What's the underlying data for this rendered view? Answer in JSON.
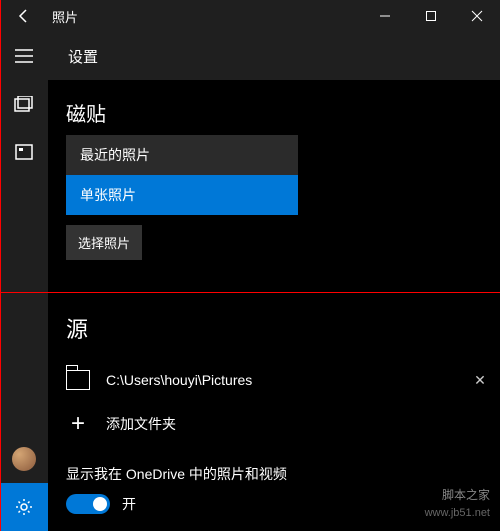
{
  "titlebar": {
    "title": "照片"
  },
  "header": {
    "title": "设置"
  },
  "tile": {
    "section_title": "磁贴",
    "option_recent": "最近的照片",
    "option_single": "单张照片",
    "select_button": "选择照片"
  },
  "sources": {
    "section_title": "源",
    "path": "C:\\Users\\houyi\\Pictures",
    "add_folder": "添加文件夹"
  },
  "onedrive": {
    "label": "显示我在 OneDrive 中的照片和视频",
    "toggle_state": "开"
  },
  "watermark": {
    "line1": "脚本之家",
    "line2": "www.jb51.net"
  }
}
